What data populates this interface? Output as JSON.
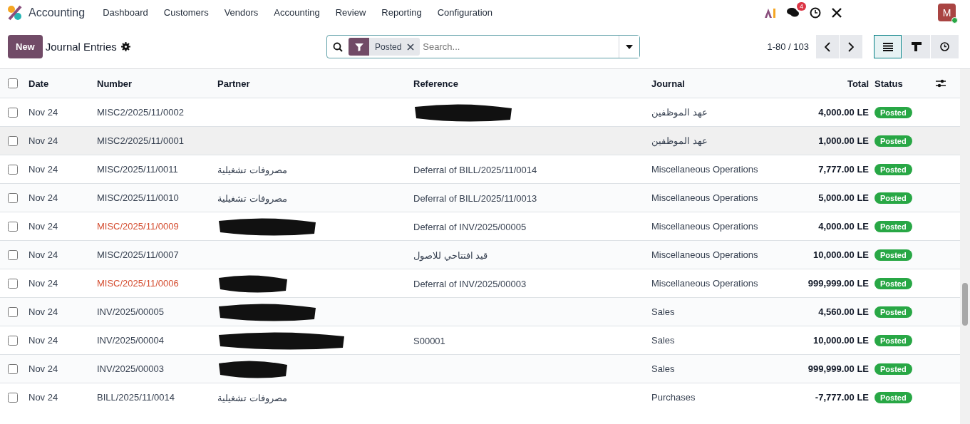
{
  "app": {
    "name": "Accounting"
  },
  "menu": [
    {
      "label": "Dashboard"
    },
    {
      "label": "Customers"
    },
    {
      "label": "Vendors"
    },
    {
      "label": "Accounting"
    },
    {
      "label": "Review"
    },
    {
      "label": "Reporting"
    },
    {
      "label": "Configuration"
    }
  ],
  "systray": {
    "messages_badge": "4",
    "avatar": "M",
    "online": true
  },
  "control_panel": {
    "new_button": "New",
    "title": "Journal Entries",
    "facets": [
      {
        "label": "Posted"
      }
    ],
    "search_placeholder": "Search...",
    "pager": "1-80 / 103",
    "views": [
      {
        "kind": "list",
        "selected": true
      },
      {
        "kind": "kanban",
        "selected": false
      },
      {
        "kind": "activity",
        "selected": false
      }
    ]
  },
  "table": {
    "all_checked": false,
    "columns": [
      "Date",
      "Number",
      "Partner",
      "Reference",
      "Journal",
      "Total",
      "Status"
    ],
    "rows": [
      {
        "checked": false,
        "date": "Nov 24",
        "number": "MISC2/2025/11/0002",
        "number_warning": false,
        "partner": "",
        "partner_redacted": false,
        "reference": "",
        "reference_redacted": true,
        "journal": "عهد الموظفين",
        "total": "4,000.00 LE",
        "status": "Posted",
        "highlighted": false
      },
      {
        "checked": false,
        "date": "Nov 24",
        "number": "MISC2/2025/11/0001",
        "number_warning": false,
        "partner": "",
        "partner_redacted": false,
        "reference": "",
        "reference_redacted": false,
        "journal": "عهد الموظفين",
        "total": "1,000.00 LE",
        "status": "Posted",
        "highlighted": true
      },
      {
        "checked": false,
        "date": "Nov 24",
        "number": "MISC/2025/11/0011",
        "number_warning": false,
        "partner": "مصروفات تشغيلية",
        "partner_redacted": false,
        "reference": "Deferral of BILL/2025/11/0014",
        "reference_redacted": false,
        "journal": "Miscellaneous Operations",
        "total": "7,777.00 LE",
        "status": "Posted",
        "highlighted": false
      },
      {
        "checked": false,
        "date": "Nov 24",
        "number": "MISC/2025/11/0010",
        "number_warning": false,
        "partner": "مصروفات تشغيلية",
        "partner_redacted": false,
        "reference": "Deferral of BILL/2025/11/0013",
        "reference_redacted": false,
        "journal": "Miscellaneous Operations",
        "total": "5,000.00 LE",
        "status": "Posted",
        "highlighted": false
      },
      {
        "checked": false,
        "date": "Nov 24",
        "number": "MISC/2025/11/0009",
        "number_warning": true,
        "partner": "",
        "partner_redacted": true,
        "reference": "Deferral of INV/2025/00005",
        "reference_redacted": false,
        "journal": "Miscellaneous Operations",
        "total": "4,000.00 LE",
        "status": "Posted",
        "highlighted": false
      },
      {
        "checked": false,
        "date": "Nov 24",
        "number": "MISC/2025/11/0007",
        "number_warning": false,
        "partner": "",
        "partner_redacted": false,
        "reference": "قيد افتتاحي للاصول",
        "reference_redacted": false,
        "journal": "Miscellaneous Operations",
        "total": "10,000.00 LE",
        "status": "Posted",
        "highlighted": false
      },
      {
        "checked": false,
        "date": "Nov 24",
        "number": "MISC/2025/11/0006",
        "number_warning": true,
        "partner": "",
        "partner_redacted": true,
        "reference": "Deferral of INV/2025/00003",
        "reference_redacted": false,
        "journal": "Miscellaneous Operations",
        "total": "999,999.00 LE",
        "status": "Posted",
        "highlighted": false
      },
      {
        "checked": false,
        "date": "Nov 24",
        "number": "INV/2025/00005",
        "number_warning": false,
        "partner": "",
        "partner_redacted": true,
        "reference": "",
        "reference_redacted": false,
        "journal": "Sales",
        "total": "4,560.00 LE",
        "status": "Posted",
        "highlighted": false
      },
      {
        "checked": false,
        "date": "Nov 24",
        "number": "INV/2025/00004",
        "number_warning": false,
        "partner": "",
        "partner_redacted": true,
        "reference": "S00001",
        "reference_redacted": false,
        "journal": "Sales",
        "total": "10,000.00 LE",
        "status": "Posted",
        "highlighted": false
      },
      {
        "checked": false,
        "date": "Nov 24",
        "number": "INV/2025/00003",
        "number_warning": false,
        "partner": "",
        "partner_redacted": true,
        "reference": "",
        "reference_redacted": false,
        "journal": "Sales",
        "total": "999,999.00 LE",
        "status": "Posted",
        "highlighted": false
      },
      {
        "checked": false,
        "date": "Nov 24",
        "number": "BILL/2025/11/0014",
        "number_warning": false,
        "partner": "مصروفات تشغيلية",
        "partner_redacted": false,
        "reference": "",
        "reference_redacted": false,
        "journal": "Purchases",
        "total": "-7,777.00 LE",
        "status": "Posted",
        "highlighted": false
      }
    ]
  }
}
